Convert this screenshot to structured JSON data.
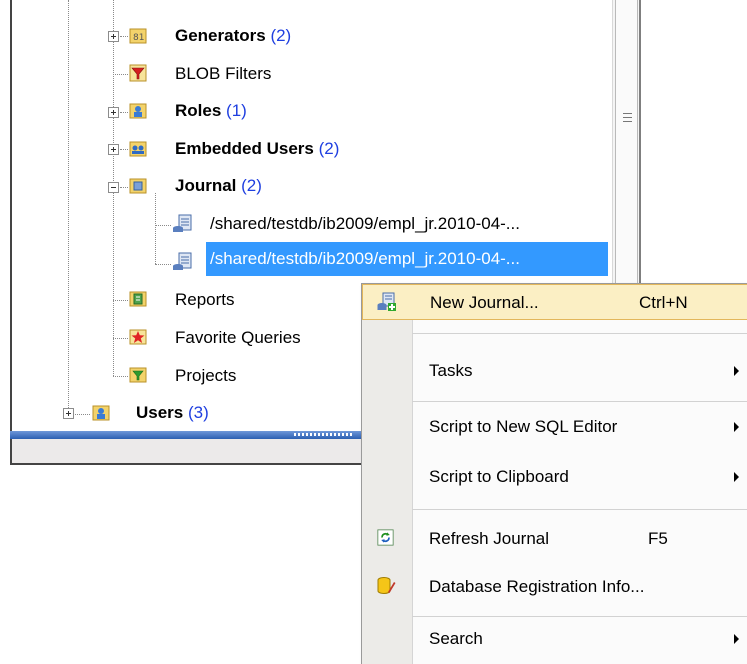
{
  "tree": {
    "items": [
      {
        "label": "Generators",
        "count": "(2)",
        "bold": true,
        "icon": "generators-icon"
      },
      {
        "label": "BLOB Filters",
        "count": "",
        "bold": false,
        "icon": "blob-filters-icon"
      },
      {
        "label": "Roles",
        "count": "(1)",
        "bold": true,
        "icon": "roles-icon"
      },
      {
        "label": "Embedded Users",
        "count": "(2)",
        "bold": true,
        "icon": "embedded-users-icon"
      },
      {
        "label": "Journal",
        "count": "(2)",
        "bold": true,
        "icon": "journal-folder-icon"
      },
      {
        "label": "/shared/testdb/ib2009/empl_jr.2010-04-...",
        "icon": "journal-file-icon"
      },
      {
        "label": "/shared/testdb/ib2009/empl_jr.2010-04-...",
        "icon": "journal-file-icon",
        "selected": true
      },
      {
        "label": "Reports",
        "count": "",
        "bold": false,
        "icon": "reports-icon"
      },
      {
        "label": "Favorite Queries",
        "count": "",
        "bold": false,
        "icon": "favorite-queries-icon"
      },
      {
        "label": "Projects",
        "count": "",
        "bold": false,
        "icon": "projects-icon"
      },
      {
        "label": "Users",
        "count": "(3)",
        "bold": true,
        "icon": "users-icon"
      }
    ]
  },
  "context_menu": {
    "new_journal": {
      "label": "New Journal...",
      "shortcut": "Ctrl+N"
    },
    "tasks": {
      "label": "Tasks"
    },
    "script_sql_editor": {
      "label": "Script to New SQL Editor"
    },
    "script_clipboard": {
      "label": "Script to Clipboard"
    },
    "refresh_journal": {
      "label": "Refresh Journal",
      "shortcut": "F5"
    },
    "db_registration": {
      "label": "Database Registration Info..."
    },
    "search": {
      "label": "Search"
    }
  },
  "colors": {
    "selection": "#3399ff",
    "count_text": "#1f3fe0",
    "menu_highlight": "#fbefc4"
  }
}
